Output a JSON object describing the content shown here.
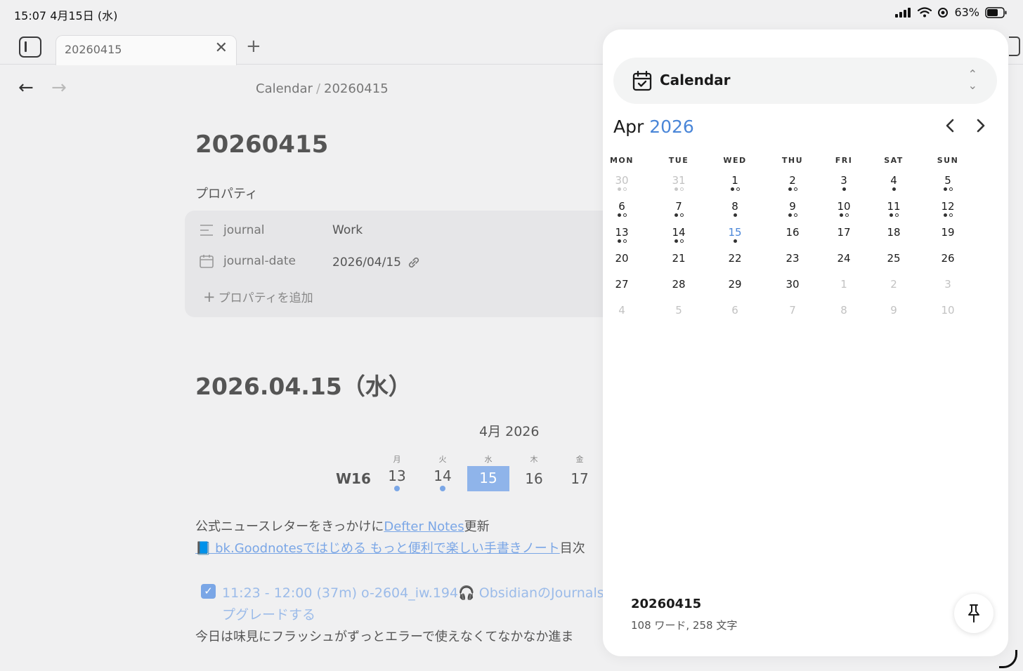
{
  "status": {
    "time_date": "15:07  4月15日 (水)",
    "battery": "63%"
  },
  "tab": {
    "title": "20260415"
  },
  "breadcrumb": {
    "parent": "Calendar",
    "current": "20260415"
  },
  "note": {
    "title": "20260415",
    "properties_label": "プロパティ",
    "properties": [
      {
        "key": "journal",
        "value": "Work",
        "icon": "list-lines-icon"
      },
      {
        "key": "journal-date",
        "value": "2026/04/15",
        "icon": "calendar-icon"
      }
    ],
    "add_property": "プロパティを追加",
    "heading": "2026.04.15（水）",
    "week": {
      "month_label": "4月  2026",
      "week_label": "W16",
      "days": [
        {
          "name": "月",
          "num": "13",
          "dot": true,
          "selected": false
        },
        {
          "name": "火",
          "num": "14",
          "dot": true,
          "selected": false
        },
        {
          "name": "水",
          "num": "15",
          "dot": false,
          "selected": true
        },
        {
          "name": "木",
          "num": "16",
          "dot": false,
          "selected": false
        },
        {
          "name": "金",
          "num": "17",
          "dot": false,
          "selected": false
        }
      ]
    },
    "line1_prefix": "公式ニュースレターをきっかけに",
    "line1_link": "Defter Notes",
    "line1_suffix": "更新",
    "line2_link": "📘 bk.Goodnotesではじめる もっと便利で楽しい手書きノート",
    "line2_suffix": "目次",
    "task_line1": "11:23 - 12:00 (37m) o-2604_iw.194🎧 ObsidianのJournals",
    "task_line2": "プグレードする",
    "line3": "今日は味見にフラッシュがずっとエラーで使えなくてなかなか進ま"
  },
  "calendar": {
    "selector_label": "Calendar",
    "month": "Apr",
    "year": "2026",
    "weekdays": [
      "MON",
      "TUE",
      "WED",
      "THU",
      "FRI",
      "SAT",
      "SUN"
    ],
    "weeks": [
      [
        {
          "d": "30",
          "out": true,
          "dots": "fo"
        },
        {
          "d": "31",
          "out": true,
          "dots": "fo"
        },
        {
          "d": "1",
          "dots": "fo"
        },
        {
          "d": "2",
          "dots": "fo"
        },
        {
          "d": "3",
          "dots": "f"
        },
        {
          "d": "4",
          "dots": "f"
        },
        {
          "d": "5",
          "dots": "fo"
        }
      ],
      [
        {
          "d": "6",
          "dots": "fo"
        },
        {
          "d": "7",
          "dots": "fo"
        },
        {
          "d": "8",
          "dots": "f"
        },
        {
          "d": "9",
          "dots": "fo"
        },
        {
          "d": "10",
          "dots": "fo"
        },
        {
          "d": "11",
          "dots": "fo"
        },
        {
          "d": "12",
          "dots": "fo"
        }
      ],
      [
        {
          "d": "13",
          "dots": "fo"
        },
        {
          "d": "14",
          "dots": "fo"
        },
        {
          "d": "15",
          "today": true,
          "dots": "f"
        },
        {
          "d": "16"
        },
        {
          "d": "17"
        },
        {
          "d": "18"
        },
        {
          "d": "19"
        }
      ],
      [
        {
          "d": "20"
        },
        {
          "d": "21"
        },
        {
          "d": "22"
        },
        {
          "d": "23"
        },
        {
          "d": "24"
        },
        {
          "d": "25"
        },
        {
          "d": "26"
        }
      ],
      [
        {
          "d": "27"
        },
        {
          "d": "28"
        },
        {
          "d": "29"
        },
        {
          "d": "30"
        },
        {
          "d": "1",
          "out": true
        },
        {
          "d": "2",
          "out": true
        },
        {
          "d": "3",
          "out": true
        }
      ],
      [
        {
          "d": "4",
          "out": true
        },
        {
          "d": "5",
          "out": true
        },
        {
          "d": "6",
          "out": true
        },
        {
          "d": "7",
          "out": true
        },
        {
          "d": "8",
          "out": true
        },
        {
          "d": "9",
          "out": true
        },
        {
          "d": "10",
          "out": true
        }
      ]
    ],
    "footer_title": "20260415",
    "footer_stats": "108 ワード, 258 文字"
  },
  "colors": {
    "accent": "#4a86d8",
    "accent_muted": "#7aa6e6",
    "selected_day_bg": "#8fb4ea"
  }
}
